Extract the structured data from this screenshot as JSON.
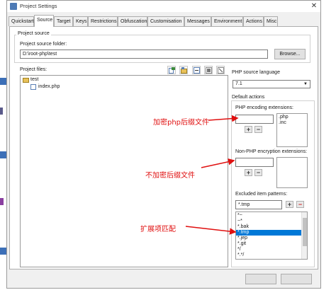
{
  "window": {
    "title": "Project Settings",
    "close_glyph": "✕"
  },
  "tabs": [
    {
      "label": "Quickstart"
    },
    {
      "label": "Source"
    },
    {
      "label": "Target"
    },
    {
      "label": "Keys"
    },
    {
      "label": "Restrictions"
    },
    {
      "label": "Obfuscation"
    },
    {
      "label": "Customisation"
    },
    {
      "label": "Messages"
    },
    {
      "label": "Environment"
    },
    {
      "label": "Actions"
    },
    {
      "label": "Misc"
    }
  ],
  "active_tab": "Source",
  "project_source": {
    "group_label": "Project source",
    "folder_label": "Project source folder:",
    "folder_value": "D:\\root-php\\test",
    "browse_label": "Browse..."
  },
  "project_files": {
    "label": "Project files:",
    "tree": [
      {
        "label": "test",
        "icon": "folder-icon"
      },
      {
        "label": "index.php",
        "icon": "php-file-icon"
      }
    ],
    "toolbar_icons": [
      "add-files-icon",
      "add-folder-icon",
      "remove-item-icon",
      "include-icon",
      "exclude-icon"
    ]
  },
  "php_source_language": {
    "label": "PHP source language",
    "value": "7.1"
  },
  "default_actions": {
    "label": "Default actions",
    "php_encoding_ext_label": "PHP encoding extensions:",
    "php_encoding_ext_input": "",
    "php_encoding_ext_list": [
      ".php",
      ".inc"
    ],
    "non_php_ext_label": "Non-PHP encryption extensions:",
    "non_php_ext_input": "",
    "non_php_ext_list": [],
    "excluded_label": "Excluded item patterns:",
    "excluded_input": "*.tmp",
    "excluded_list": [
      "*~",
      "~*",
      "*.bak",
      "*.tmp",
      "*.jep",
      "*.git",
      "*/",
      "*.*/"
    ],
    "excluded_selected": "*.tmp"
  },
  "annotations": {
    "php_ext": "加密php后缀文件",
    "non_php_ext": "不加密后缀文件",
    "excluded": "扩展项匹配"
  },
  "colors": {
    "annotation": "#e01010",
    "selection": "#0078d7"
  }
}
